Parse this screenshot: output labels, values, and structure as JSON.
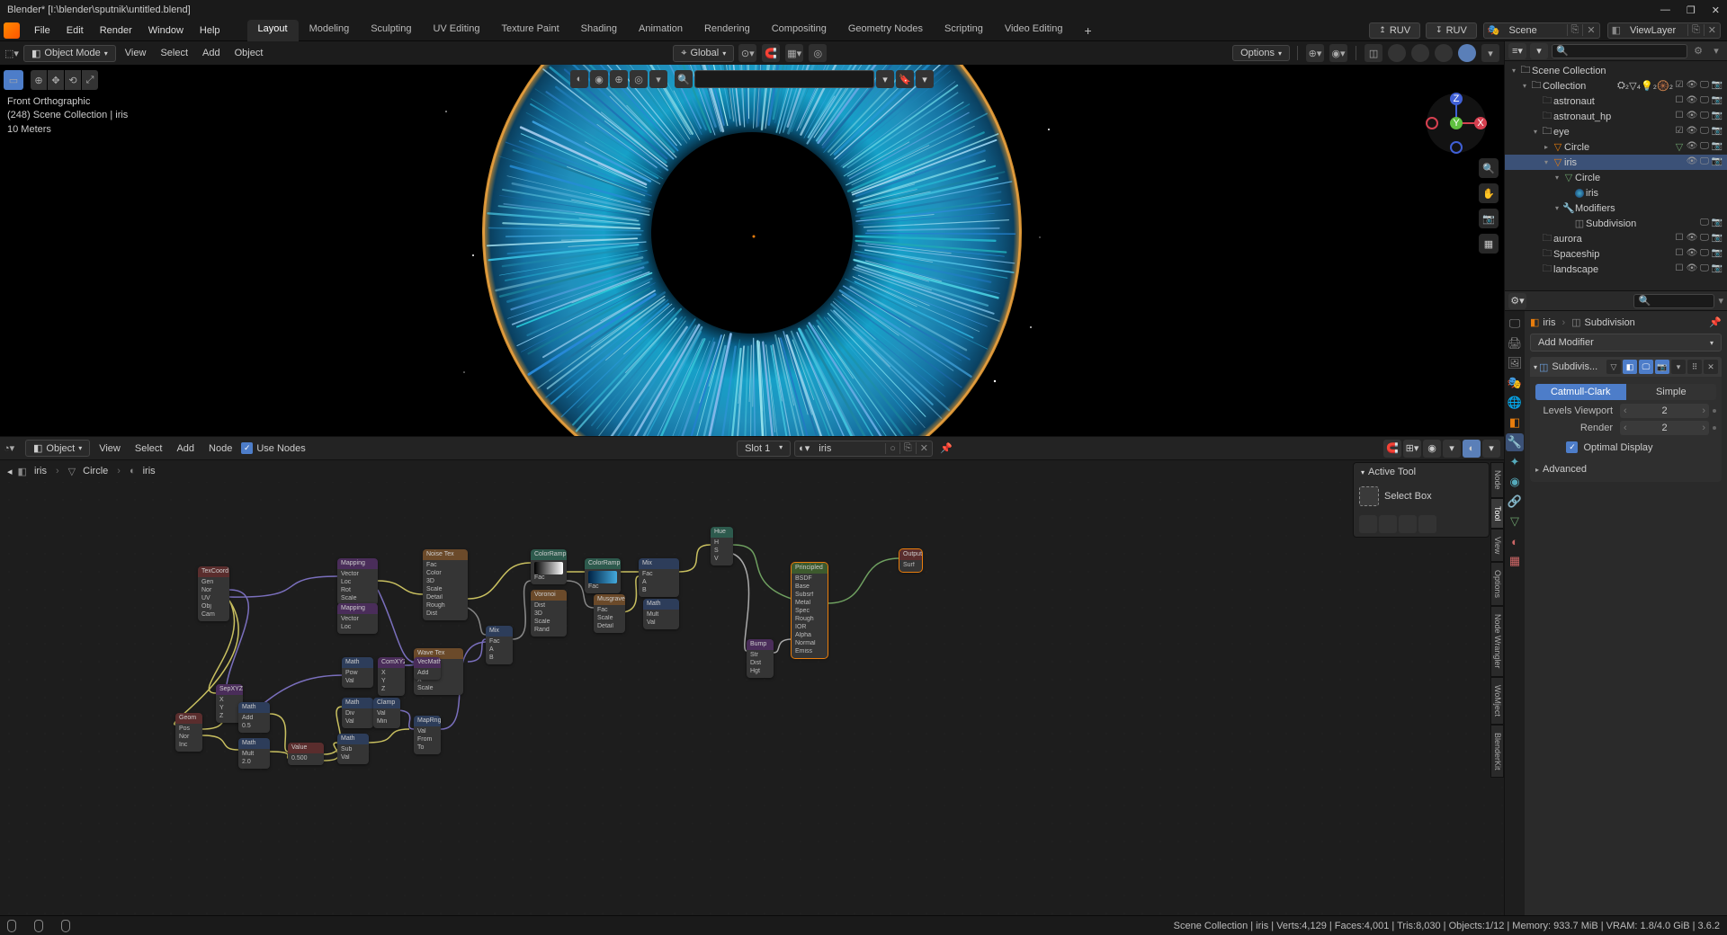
{
  "window": {
    "title": "Blender* [I:\\blender\\sputnik\\untitled.blend]"
  },
  "menubar": {
    "items": [
      "File",
      "Edit",
      "Render",
      "Window",
      "Help"
    ],
    "workspaces": [
      "Layout",
      "Modeling",
      "Sculpting",
      "UV Editing",
      "Texture Paint",
      "Shading",
      "Animation",
      "Rendering",
      "Compositing",
      "Geometry Nodes",
      "Scripting",
      "Video Editing"
    ],
    "active_workspace": "Layout",
    "ruv_up": "RUV",
    "ruv_down": "RUV",
    "scene_label": "Scene",
    "viewlayer_label": "ViewLayer"
  },
  "viewport": {
    "mode": "Object Mode",
    "menus": [
      "View",
      "Select",
      "Add",
      "Object"
    ],
    "orientation": "Global",
    "info_line1": "Front Orthographic",
    "info_line2": "(248) Scene Collection | iris",
    "info_line3": "10 Meters",
    "options_label": "Options"
  },
  "node_editor": {
    "editor_type": "Object",
    "menus": [
      "View",
      "Select",
      "Add",
      "Node"
    ],
    "use_nodes_label": "Use Nodes",
    "slot": "Slot 1",
    "material": "iris",
    "breadcrumb": [
      "iris",
      "Circle",
      "iris"
    ],
    "side_tabs": [
      "Node",
      "Tool",
      "View",
      "Options",
      "Node Wrangler",
      "WoMject",
      "BlenderKit"
    ],
    "active_tool_label": "Active Tool",
    "select_box_label": "Select Box"
  },
  "outliner": {
    "scene_collection": "Scene Collection",
    "items": [
      {
        "name": "Collection",
        "type": "collection",
        "depth": 1,
        "open": true
      },
      {
        "name": "astronaut",
        "type": "collection",
        "depth": 2,
        "muted": true
      },
      {
        "name": "astronaut_hp",
        "type": "collection",
        "depth": 2,
        "muted": true
      },
      {
        "name": "eye",
        "type": "collection",
        "depth": 2,
        "open": true,
        "checked": true
      },
      {
        "name": "Circle",
        "type": "mesh",
        "depth": 3
      },
      {
        "name": "iris",
        "type": "mesh",
        "depth": 3,
        "open": true,
        "selected": true
      },
      {
        "name": "Circle",
        "type": "meshdata",
        "depth": 4
      },
      {
        "name": "iris",
        "type": "material",
        "depth": 5
      },
      {
        "name": "Modifiers",
        "type": "modifiers",
        "depth": 4,
        "open": true
      },
      {
        "name": "Subdivision",
        "type": "modifier",
        "depth": 5
      },
      {
        "name": "aurora",
        "type": "collection",
        "depth": 2,
        "muted": true
      },
      {
        "name": "Spaceship",
        "type": "collection",
        "depth": 2,
        "muted": true
      },
      {
        "name": "landscape",
        "type": "collection",
        "depth": 2,
        "muted": true
      }
    ]
  },
  "properties": {
    "breadcrumb_obj": "iris",
    "breadcrumb_mod": "Subdivision",
    "add_modifier": "Add Modifier",
    "modifier_name": "Subdivis...",
    "seg_catmull": "Catmull-Clark",
    "seg_simple": "Simple",
    "levels_viewport_label": "Levels Viewport",
    "levels_viewport_val": "2",
    "render_label": "Render",
    "render_val": "2",
    "optimal_display": "Optimal Display",
    "advanced": "Advanced"
  },
  "statusbar": {
    "stats": "Scene Collection | iris | Verts:4,129 | Faces:4,001 | Tris:8,030 | Objects:1/12 | Memory: 933.7 MiB | VRAM: 1.8/4.0 GiB | 3.6.2"
  }
}
